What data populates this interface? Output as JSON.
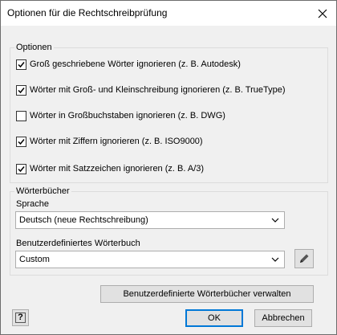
{
  "window": {
    "title": "Optionen für die Rechtschreibprüfung"
  },
  "options": {
    "legend": "Optionen",
    "items": [
      {
        "label": "Groß geschriebene Wörter ignorieren (z. B. Autodesk)",
        "checked": true
      },
      {
        "label": "Wörter mit Groß- und Kleinschreibung ignorieren (z. B. TrueType)",
        "checked": true
      },
      {
        "label": "Wörter in Großbuchstaben ignorieren (z. B. DWG)",
        "checked": false
      },
      {
        "label": "Wörter mit Ziffern ignorieren (z. B. ISO9000)",
        "checked": true
      },
      {
        "label": "Wörter mit Satzzeichen ignorieren (z. B. A/3)",
        "checked": true
      }
    ]
  },
  "dictionaries": {
    "legend": "Wörterbücher",
    "language_label": "Sprache",
    "language_value": "Deutsch (neue Rechtschreibung)",
    "custom_label": "Benutzerdefiniertes Wörterbuch",
    "custom_value": "Custom"
  },
  "buttons": {
    "manage": "Benutzerdefinierte Wörterbücher verwalten",
    "ok": "OK",
    "cancel": "Abbrechen",
    "help": "?"
  },
  "icons": {
    "close": "close-icon",
    "check": "checkmark-icon",
    "dropdown": "chevron-down-icon",
    "edit": "pencil-icon",
    "help": "help-icon"
  }
}
